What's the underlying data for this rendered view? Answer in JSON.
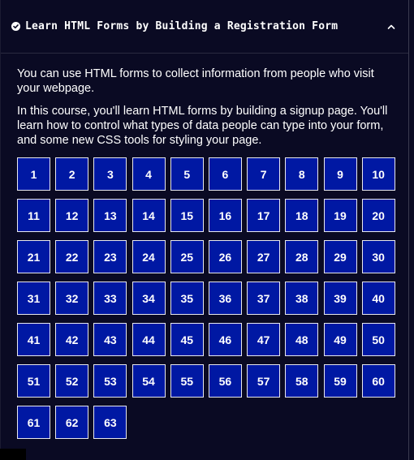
{
  "header": {
    "title": "Learn HTML Forms by Building a Registration Form",
    "check_icon": "check-circle-icon",
    "toggle_icon": "caret-up-icon"
  },
  "intro": {
    "paragraph_1": "You can use HTML forms to collect information from people who visit your webpage.",
    "paragraph_2": "In this course, you'll learn HTML forms by building a signup page. You'll learn how to control what types of data people can type into your form, and some new CSS tools for styling your page."
  },
  "steps": [
    "1",
    "2",
    "3",
    "4",
    "5",
    "6",
    "7",
    "8",
    "9",
    "10",
    "11",
    "12",
    "13",
    "14",
    "15",
    "16",
    "17",
    "18",
    "19",
    "20",
    "21",
    "22",
    "23",
    "24",
    "25",
    "26",
    "27",
    "28",
    "29",
    "30",
    "31",
    "32",
    "33",
    "34",
    "35",
    "36",
    "37",
    "38",
    "39",
    "40",
    "41",
    "42",
    "43",
    "44",
    "45",
    "46",
    "47",
    "48",
    "49",
    "50",
    "51",
    "52",
    "53",
    "54",
    "55",
    "56",
    "57",
    "58",
    "59",
    "60",
    "61",
    "62",
    "63"
  ],
  "colors": {
    "background": "#0a0a23",
    "step_fill": "#0018a3",
    "step_border": "#e8e8ef",
    "text": "#ffffff"
  }
}
